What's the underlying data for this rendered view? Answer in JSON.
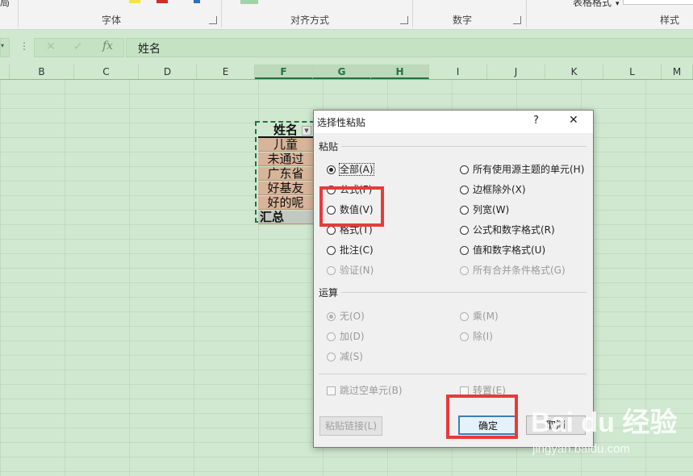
{
  "ribbon": {
    "font_group": "字体",
    "align_group": "对齐方式",
    "number_group": "数字",
    "styles_group": "样式",
    "table_format": "表格格式"
  },
  "formula_bar": {
    "cancel_icon": "close-icon",
    "enter_icon": "check-icon",
    "fx_label": "fx",
    "value": "姓名"
  },
  "columns": [
    "B",
    "C",
    "D",
    "E",
    "F",
    "G",
    "H",
    "I",
    "J",
    "K",
    "L",
    "M"
  ],
  "cells": {
    "header": "姓名",
    "rows": [
      "儿童",
      "未通过",
      "广东省",
      "好基友",
      "好的呢"
    ],
    "total": "汇总"
  },
  "dialog": {
    "title": "选择性粘贴",
    "help": "?",
    "close": "✕",
    "paste_section": "粘贴",
    "paste_left": [
      {
        "label": "全部(A)",
        "checked": true,
        "enabled": true
      },
      {
        "label": "公式(F)",
        "checked": false,
        "enabled": true
      },
      {
        "label": "数值(V)",
        "checked": false,
        "enabled": true
      },
      {
        "label": "格式(T)",
        "checked": false,
        "enabled": true
      },
      {
        "label": "批注(C)",
        "checked": false,
        "enabled": true
      },
      {
        "label": "验证(N)",
        "checked": false,
        "enabled": false
      }
    ],
    "paste_right": [
      {
        "label": "所有使用源主题的单元(H)",
        "checked": false,
        "enabled": true
      },
      {
        "label": "边框除外(X)",
        "checked": false,
        "enabled": true
      },
      {
        "label": "列宽(W)",
        "checked": false,
        "enabled": true
      },
      {
        "label": "公式和数字格式(R)",
        "checked": false,
        "enabled": true
      },
      {
        "label": "值和数字格式(U)",
        "checked": false,
        "enabled": true
      },
      {
        "label": "所有合并条件格式(G)",
        "checked": false,
        "enabled": false
      }
    ],
    "operation_section": "运算",
    "op_left": [
      {
        "label": "无(O)",
        "checked": true
      },
      {
        "label": "加(D)",
        "checked": false
      },
      {
        "label": "减(S)",
        "checked": false
      }
    ],
    "op_right": [
      {
        "label": "乘(M)",
        "checked": false
      },
      {
        "label": "除(I)",
        "checked": false
      }
    ],
    "skip_blanks": "跳过空单元(B)",
    "transpose": "转置(E)",
    "paste_link": "粘贴链接(L)",
    "ok": "确定",
    "cancel": "取消"
  },
  "watermark": {
    "brand": "Bai du 经验",
    "url": "jingyan.baidu.com"
  },
  "colors": {
    "grid_bg": "#cfe8cf",
    "excel_green": "#217346",
    "highlight_red": "#e83a3a"
  }
}
